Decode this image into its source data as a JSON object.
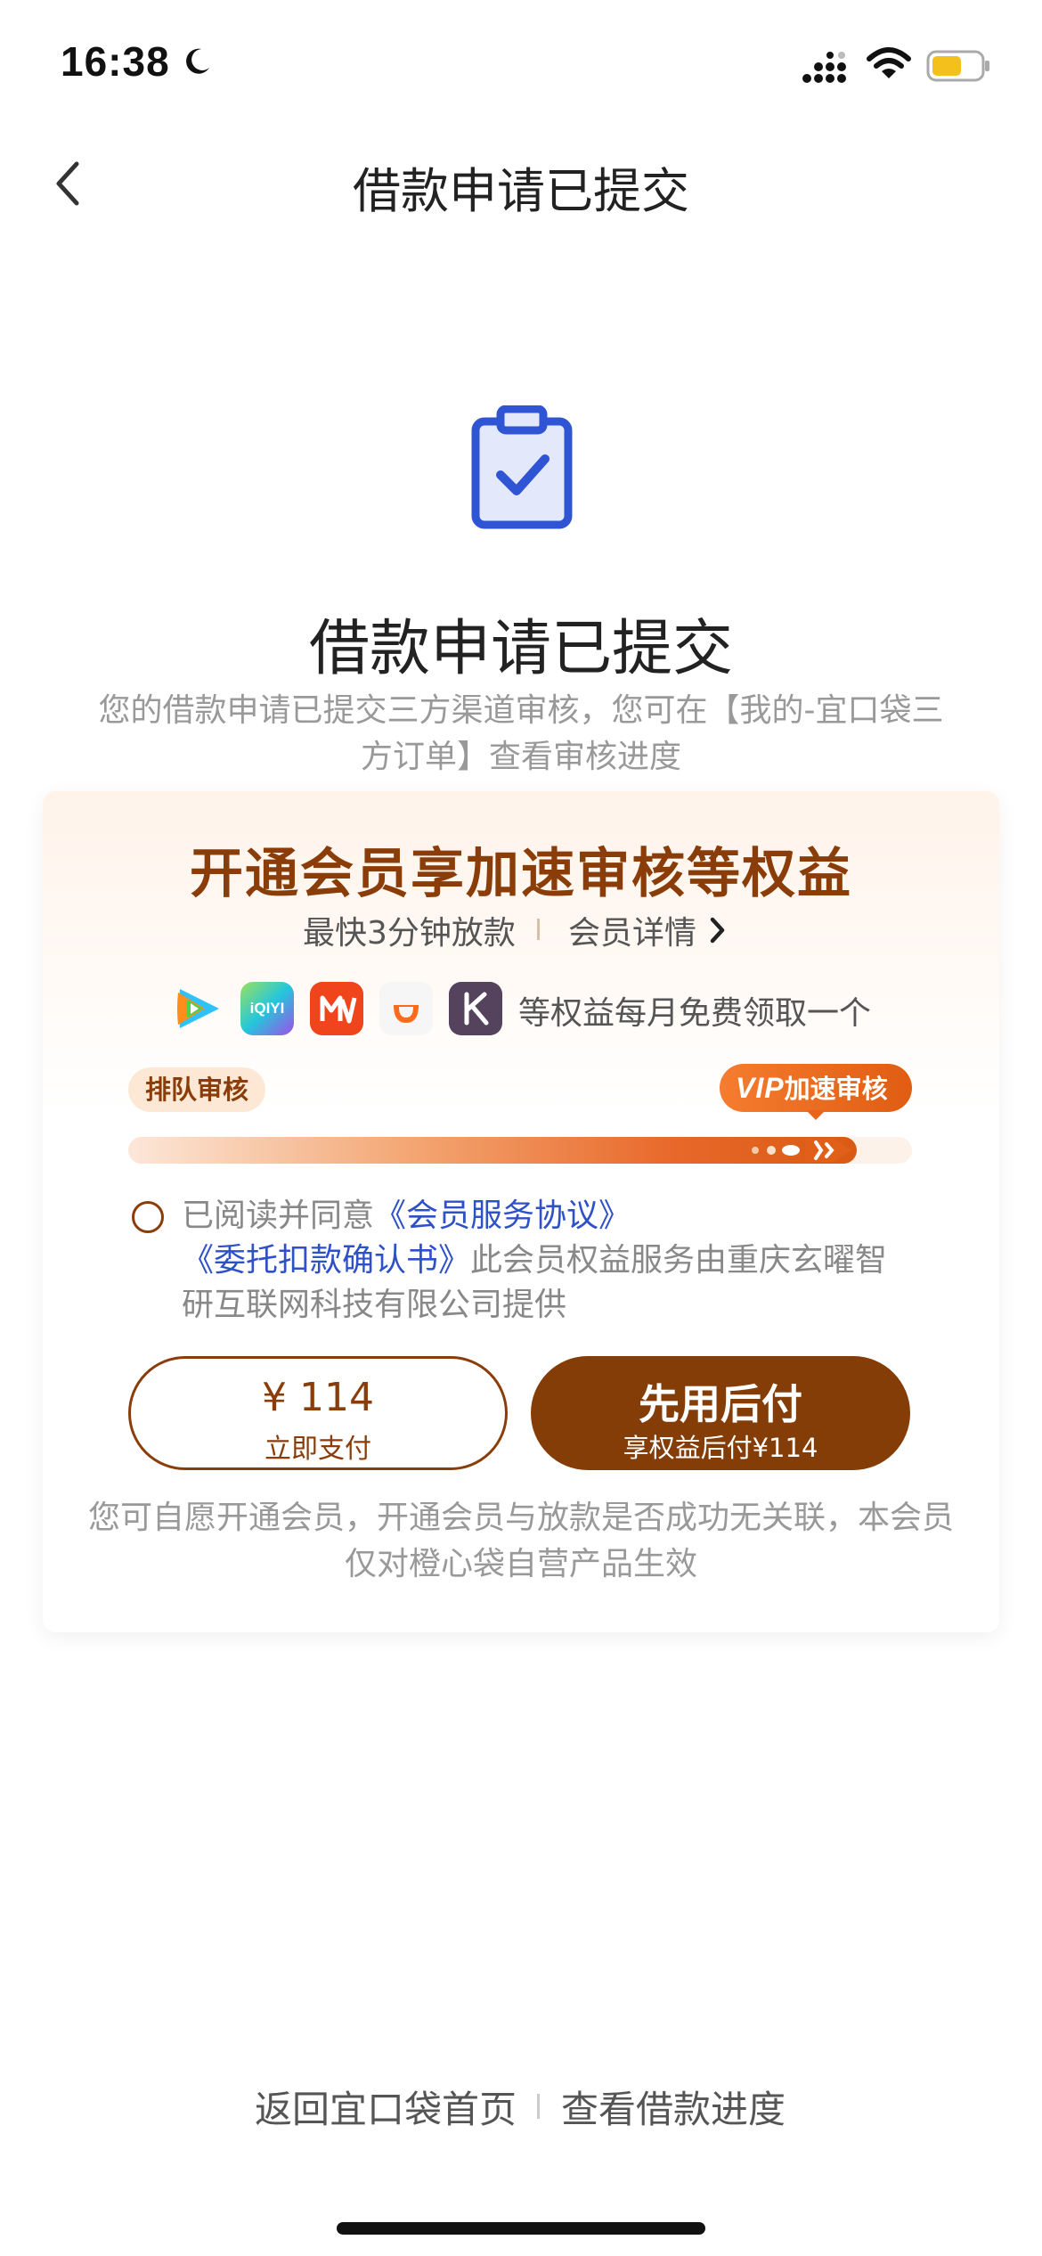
{
  "status_bar": {
    "time": "16:38"
  },
  "nav": {
    "title": "借款申请已提交"
  },
  "hero": {
    "title": "借款申请已提交",
    "description": "您的借款申请已提交三方渠道审核，您可在【我的-宜口袋三方订单】查看审核进度"
  },
  "membership": {
    "title": "开通会员享加速审核等权益",
    "subtitle": "最快3分钟放款",
    "detail_link": "会员详情",
    "apps": [
      {
        "name": "腾讯视频",
        "icon": "tencent-video-icon"
      },
      {
        "name": "爱奇艺",
        "icon": "iqiyi-icon",
        "text": "iQIYI"
      },
      {
        "name": "芒果TV",
        "icon": "mango-tv-icon"
      },
      {
        "name": "滴滴",
        "icon": "didi-icon"
      },
      {
        "name": "Keep",
        "icon": "keep-icon"
      }
    ],
    "apps_text": "等权益每月免费领取一个",
    "queue_label": "排队审核",
    "vip_prefix": "VIP",
    "vip_label": "加速审核",
    "progress_fraction": 0.93,
    "agreement": {
      "prefix": "已阅读并同意",
      "link1": "《会员服务协议》",
      "link2": "《委托扣款确认书》",
      "suffix": "此会员权益服务由重庆玄曜智研互联网科技有限公司提供"
    },
    "pay_button": {
      "amount": "¥ 114",
      "label": "立即支付"
    },
    "later_button": {
      "title": "先用后付",
      "sub": "享权益后付¥114"
    },
    "note": "您可自愿开通会员，开通会员与放款是否成功无关联，本会员仅对橙心袋自营产品生效"
  },
  "footer": {
    "home_link": "返回宜口袋首页",
    "progress_link": "查看借款进度"
  },
  "colors": {
    "brand_brown": "#853d07",
    "link_blue": "#2f51c7",
    "icon_blue": "#2f55d4"
  }
}
